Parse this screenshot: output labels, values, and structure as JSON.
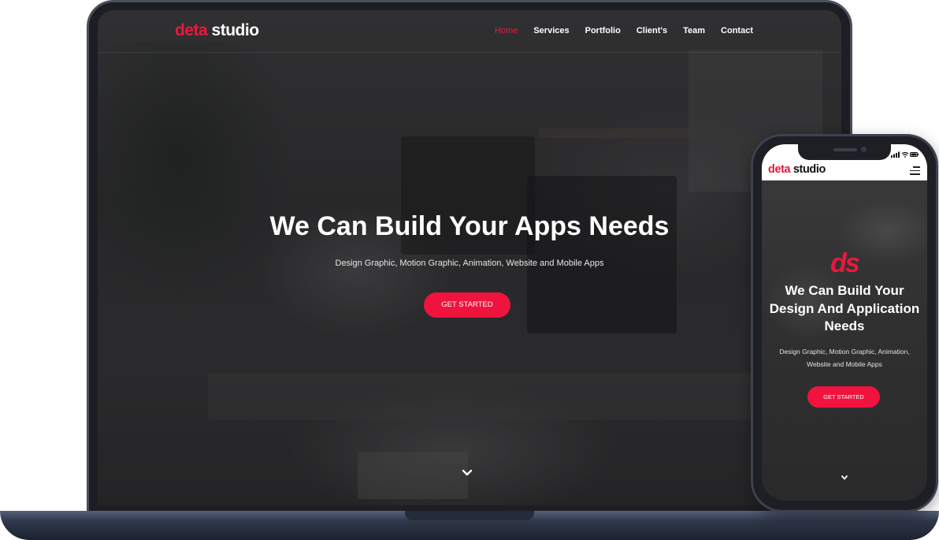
{
  "brand": {
    "red_part": "deta",
    "white_part": "studio",
    "accent_color": "#f0133d"
  },
  "desktop": {
    "nav_items": [
      {
        "label": "Home",
        "active": true
      },
      {
        "label": "Services",
        "active": false
      },
      {
        "label": "Portfolio",
        "active": false
      },
      {
        "label": "Client's",
        "active": false
      },
      {
        "label": "Team",
        "active": false
      },
      {
        "label": "Contact",
        "active": false
      }
    ],
    "hero_title": "We Can Build Your Apps Needs",
    "hero_subtitle": "Design Graphic, Motion Graphic, Animation, Website and Mobile Apps",
    "cta_label": "GET STARTED",
    "scroll_icon": "chevron-down-icon"
  },
  "mobile": {
    "monogram": "ds",
    "hero_title": "We Can Build Your Design And Application Needs",
    "hero_subtitle": "Design Graphic, Motion Graphic, Animation, Website and Mobile Apps",
    "cta_label": "GET STARTED",
    "menu_icon": "hamburger-menu-icon",
    "scroll_icon": "chevron-down-icon",
    "status_icons": "signal-wifi-battery-icons"
  }
}
